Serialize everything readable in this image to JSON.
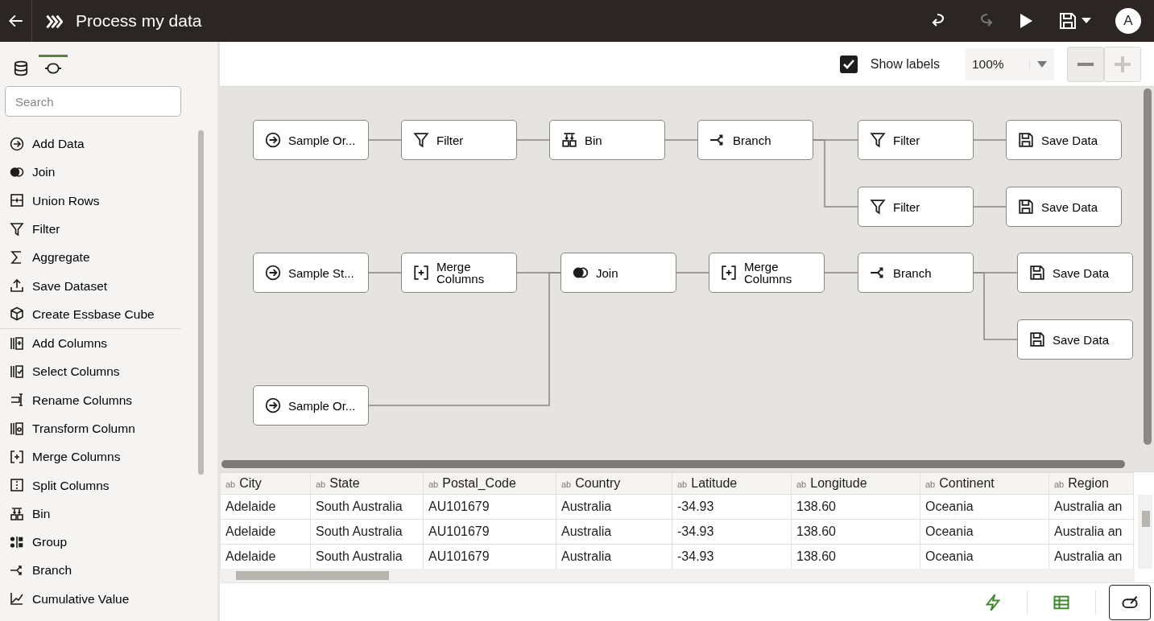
{
  "header": {
    "title": "Process my data",
    "redo_disabled": true,
    "avatar": "A"
  },
  "sidebar_tabs": [
    {
      "kind": "database",
      "selected": false
    },
    {
      "kind": "flow",
      "selected": true
    }
  ],
  "search": {
    "placeholder": "Search"
  },
  "steps": [
    {
      "label": "Add Data",
      "kind": "add"
    },
    {
      "label": "Join",
      "kind": "join"
    },
    {
      "label": "Union Rows",
      "kind": "union"
    },
    {
      "label": "Filter",
      "kind": "filter"
    },
    {
      "label": "Aggregate",
      "kind": "sigma"
    },
    {
      "label": "Save Dataset",
      "kind": "upload"
    },
    {
      "label": "Create Essbase Cube",
      "kind": "cube"
    },
    {
      "label": "Add Columns",
      "kind": "addcol"
    },
    {
      "label": "Select Columns",
      "kind": "selcol"
    },
    {
      "label": "Rename Columns",
      "kind": "rename"
    },
    {
      "label": "Transform Column",
      "kind": "transform"
    },
    {
      "label": "Merge Columns",
      "kind": "merge"
    },
    {
      "label": "Split Columns",
      "kind": "split"
    },
    {
      "label": "Bin",
      "kind": "bin"
    },
    {
      "label": "Group",
      "kind": "group"
    },
    {
      "label": "Branch",
      "kind": "branch"
    },
    {
      "label": "Cumulative Value",
      "kind": "cumulative"
    }
  ],
  "toolbar": {
    "show_labels": {
      "label": "Show labels",
      "checked": true
    },
    "zoom": "100%",
    "zoom_in_disabled": true
  },
  "nodes": [
    {
      "label": "Sample Or...",
      "kind": "add"
    },
    {
      "label": "Filter",
      "kind": "filter"
    },
    {
      "label": "Bin",
      "kind": "bin"
    },
    {
      "label": "Branch",
      "kind": "branch"
    },
    {
      "label": "Filter",
      "kind": "filter"
    },
    {
      "label": "Save Data",
      "kind": "save"
    },
    {
      "label": "Filter",
      "kind": "filter"
    },
    {
      "label": "Save Data",
      "kind": "save"
    },
    {
      "label": "Sample St...",
      "kind": "add"
    },
    {
      "label": "Merge Columns",
      "kind": "merge"
    },
    {
      "label": "Join",
      "kind": "join"
    },
    {
      "label": "Merge Columns",
      "kind": "merge"
    },
    {
      "label": "Branch",
      "kind": "branch"
    },
    {
      "label": "Save Data",
      "kind": "save"
    },
    {
      "label": "Save Data",
      "kind": "save"
    },
    {
      "label": "Sample Or...",
      "kind": "add"
    }
  ],
  "table": {
    "columns": [
      {
        "type": "ab",
        "name": "City"
      },
      {
        "type": "ab",
        "name": "State"
      },
      {
        "type": "ab",
        "name": "Postal_Code"
      },
      {
        "type": "ab",
        "name": "Country"
      },
      {
        "type": "ab",
        "name": "Latitude"
      },
      {
        "type": "ab",
        "name": "Longitude"
      },
      {
        "type": "ab",
        "name": "Continent"
      },
      {
        "type": "ab",
        "name": "Region"
      }
    ],
    "rows": [
      [
        "Adelaide",
        "South Australia",
        "AU101679",
        "Australia",
        "-34.93",
        "138.60",
        "Oceania",
        "Australia an"
      ],
      [
        "Adelaide",
        "South Australia",
        "AU101679",
        "Australia",
        "-34.93",
        "138.60",
        "Oceania",
        "Australia an"
      ],
      [
        "Adelaide",
        "South Australia",
        "AU101679",
        "Australia",
        "-34.93",
        "138.60",
        "Oceania",
        "Australia an"
      ]
    ]
  },
  "footer_buttons": [
    {
      "kind": "lightning",
      "selected": false
    },
    {
      "kind": "grid",
      "selected": false
    },
    {
      "kind": "edit",
      "selected": true
    }
  ]
}
